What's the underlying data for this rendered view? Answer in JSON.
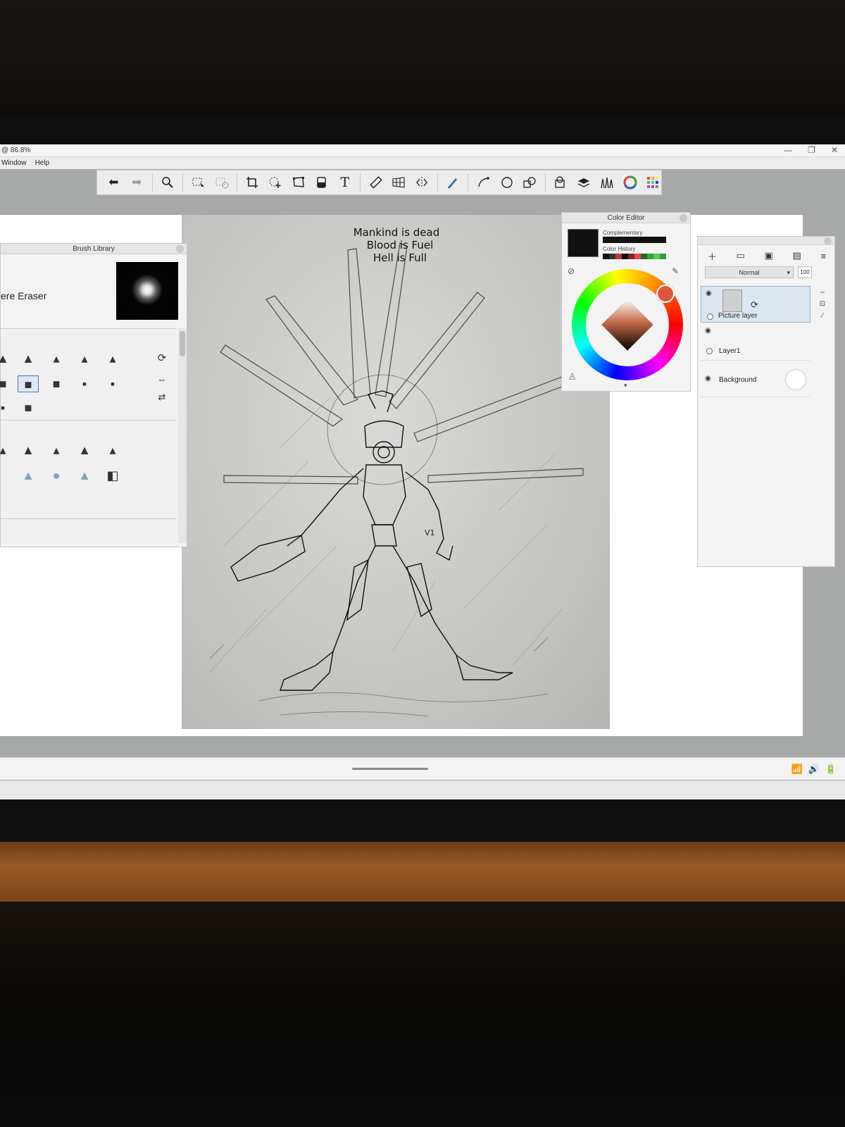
{
  "window": {
    "title": "@ 86.8%",
    "minimize_glyph": "—",
    "maximize_glyph": "❐",
    "close_glyph": "✕"
  },
  "menu": [
    "Window",
    "Help"
  ],
  "toolbar": {
    "tools": [
      "undo-icon",
      "redo-icon",
      "zoom-icon",
      "select-icon",
      "deselect-icon",
      "crop-icon",
      "transform-icon",
      "distort-icon",
      "fill-icon",
      "text-icon",
      "ruler-icon",
      "perspective-icon",
      "symmetry-icon",
      "pen-icon",
      "curve-icon",
      "ellipse-icon",
      "shape-icon",
      "copic-icon",
      "layers-icon",
      "brushes-icon",
      "color-editor-icon",
      "color-puck-icon"
    ]
  },
  "brush_library": {
    "title": "Brush Library",
    "brush_name": "ere Eraser"
  },
  "canvas": {
    "text_line1": "Mankind is dead",
    "text_line2": "Blood is Fuel",
    "text_line3": "Hell is Full",
    "mark": "V1"
  },
  "color_editor": {
    "title": "Color Editor",
    "complementary_label": "Complementary",
    "history_label": "Color History",
    "current_color": "#111111",
    "history": [
      "#111111",
      "#333333",
      "#cc3333",
      "#111111",
      "#882222",
      "#ee4444",
      "#226622",
      "#33aa33",
      "#55cc55",
      "#2e9f3a"
    ],
    "handle_color": "#e0553b"
  },
  "layers": {
    "blend_mode": "Normal",
    "opacity": "100",
    "items": [
      {
        "name": "Picture layer"
      },
      {
        "name": "Layer1"
      },
      {
        "name": "Background"
      }
    ]
  }
}
